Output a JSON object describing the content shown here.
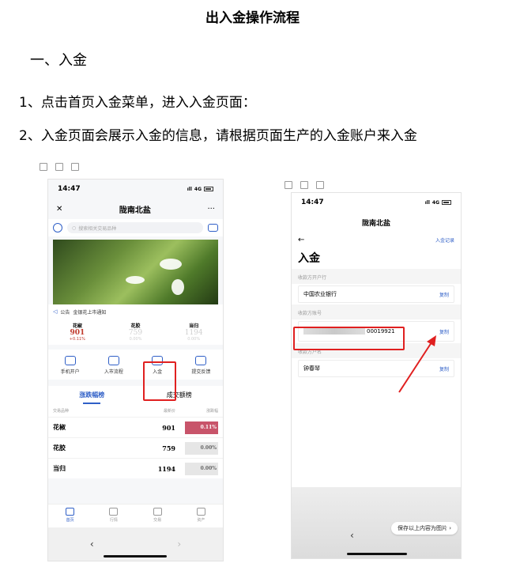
{
  "doc": {
    "title": "出入金操作流程",
    "section": "一、入金",
    "step1": "1、点击首页入金菜单，进入入金页面：",
    "step2": "2、入金页面会展示入金的信息，请根据页面生产的入金账户来入金"
  },
  "phone1": {
    "time": "14:47",
    "signal": "4G",
    "nav_close": "✕",
    "nav_title": "陇南北盐",
    "nav_more": "···",
    "search_placeholder": "搜索相关交易品种",
    "notice_label": "公告",
    "notice_text": "金银花上市通知",
    "quotes": [
      {
        "name": "花椒",
        "price": "901",
        "change": "+0.11%"
      },
      {
        "name": "花胶",
        "price": "759",
        "change": "0.00%"
      },
      {
        "name": "当归",
        "price": "1194",
        "change": "0.00%"
      }
    ],
    "menu": [
      "手机开户",
      "入市流程",
      "入金",
      "提交反馈"
    ],
    "tabs": [
      "涨跌幅榜",
      "成交额榜"
    ],
    "table_headers": [
      "交易品种",
      "最新价",
      "涨跌幅"
    ],
    "rows": [
      {
        "name": "花椒",
        "price": "901",
        "change": "0.11%"
      },
      {
        "name": "花胶",
        "price": "759",
        "change": "0.00%"
      },
      {
        "name": "当归",
        "price": "1194",
        "change": "0.00%"
      }
    ],
    "bottom_nav": [
      "首页",
      "行情",
      "交易",
      "资产"
    ],
    "sys_back": "‹",
    "sys_forward": "›"
  },
  "phone2": {
    "time": "14:47",
    "signal": "4G",
    "nav_title": "陇南北盐",
    "back": "←",
    "record_link": "入金记录",
    "heading": "入金",
    "bank_label": "收款方开户行",
    "bank_value": "中国农业银行",
    "account_label": "收款方账号",
    "account_value": "00019921",
    "name_label": "收款方户名",
    "name_value": "钟春琴",
    "copy": "复制",
    "save_pill": "保存以上内容为图片 ›",
    "sys_back": "‹"
  },
  "colors": {
    "accent": "#2f5fc7",
    "highlight": "#e02020",
    "up": "#c8546a"
  }
}
